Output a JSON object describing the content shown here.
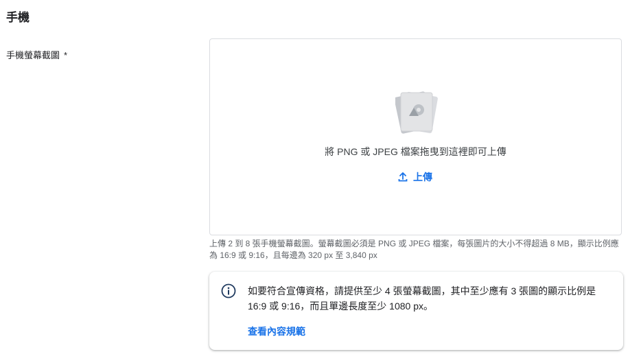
{
  "section": {
    "title": "手機"
  },
  "field": {
    "label": "手機螢幕截圖",
    "required_mark": "*"
  },
  "dropzone": {
    "drop_text": "將 PNG 或 JPEG 檔案拖曳到這裡即可上傳",
    "upload_label": "上傳",
    "icon": "image-placeholder-icon"
  },
  "helper_text": "上傳 2 到 8 張手機螢幕截圖。螢幕截圖必須是 PNG 或 JPEG 檔案，每張圖片的大小不得超過 8 MB，顯示比例應為 16:9 或 9:16，且每邊為 320 px 至 3,840 px",
  "info_card": {
    "icon": "info-icon",
    "text": "如要符合宣傳資格，請提供至少 4 張螢幕截圖，其中至少應有 3 張圖的顯示比例是 16:9 或 9:16，而且單邊長度至少 1080 px。",
    "link_label": "查看內容規範"
  },
  "colors": {
    "accent": "#1a73e8",
    "border": "#dadce0",
    "secondary_text": "#5f6368"
  }
}
